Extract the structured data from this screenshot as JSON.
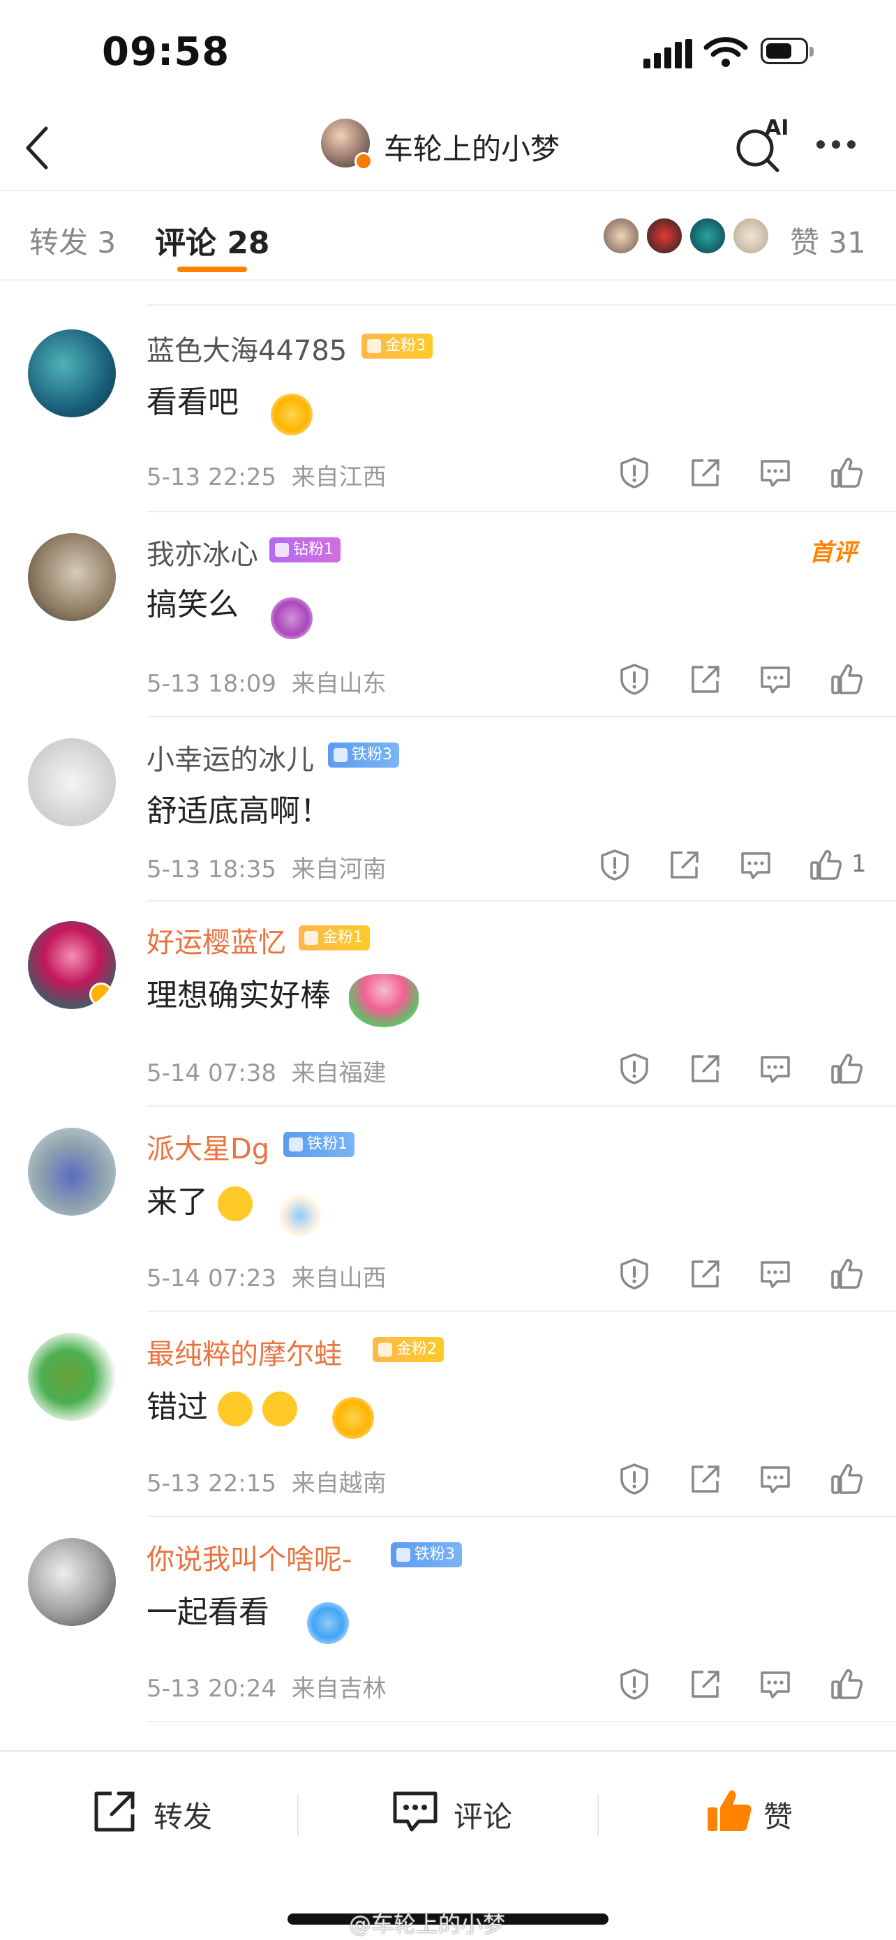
{
  "status_bar": {
    "time": "09:58"
  },
  "nav": {
    "title": "车轮上的小梦"
  },
  "tabs": {
    "repost": "转发 3",
    "comments": "评论 28",
    "likes": "赞 31"
  },
  "comments": [
    {
      "username": "蓝色大海44785",
      "badge": "金粉3",
      "text": "看看吧",
      "time": "5-13 22:25",
      "location": "来自江西",
      "likes": ""
    },
    {
      "username": "我亦冰心",
      "badge": "钻粉1",
      "text": "搞笑么",
      "time": "5-13 18:09",
      "location": "来自山东",
      "likes": "",
      "tag": "首评"
    },
    {
      "username": "小幸运的冰儿",
      "badge": "铁粉3",
      "text": "舒适底高啊！",
      "time": "5-13 18:35",
      "location": "来自河南",
      "likes": "1"
    },
    {
      "username": "好运樱蓝忆",
      "badge": "金粉1",
      "text": "理想确实好棒",
      "time": "5-14 07:38",
      "location": "来自福建",
      "likes": ""
    },
    {
      "username": "派大星Dg",
      "badge": "铁粉1",
      "text": "来了",
      "time": "5-14 07:23",
      "location": "来自山西",
      "likes": ""
    },
    {
      "username": "最纯粹的摩尔蛙",
      "badge": "金粉2",
      "text": "错过",
      "time": "5-13 22:15",
      "location": "来自越南",
      "likes": ""
    },
    {
      "username": "你说我叫个啥呢-",
      "badge": "铁粉3",
      "text": "一起看看",
      "time": "5-13 20:24",
      "location": "来自吉林",
      "likes": ""
    }
  ],
  "bottom_bar": {
    "repost": "转发",
    "comment": "评论",
    "like": "赞"
  },
  "watermark": "@车轮上的小梦",
  "colors": {
    "accent": "#ff8200",
    "vip_name": "#eb7340"
  }
}
